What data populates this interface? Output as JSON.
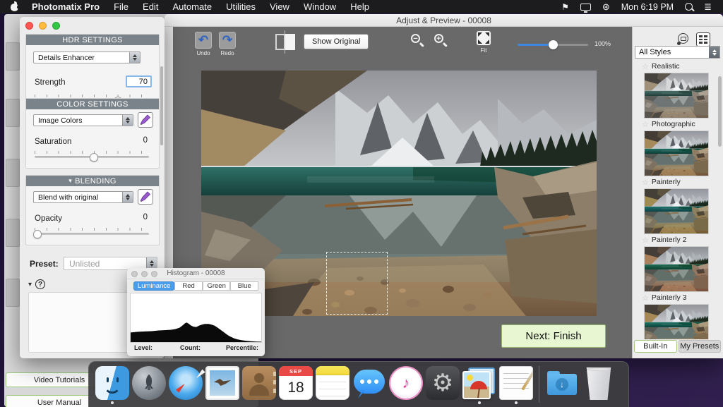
{
  "menu_bar": {
    "app_name": "Photomatix Pro",
    "items": [
      "File",
      "Edit",
      "Automate",
      "Utilities",
      "View",
      "Window",
      "Help"
    ],
    "clock": "Mon 6:19 PM"
  },
  "adjust_window": {
    "title": "Adjust & Preview - 00008",
    "toolbar": {
      "undo": "Undo",
      "redo": "Redo",
      "show_original": "Show Original",
      "fit": "Fit",
      "zoom_percent": "100%"
    },
    "next_button": "Next: Finish"
  },
  "settings_panel": {
    "hdr": {
      "header": "HDR SETTINGS",
      "method": "Details Enhancer",
      "strength": {
        "label": "Strength",
        "value": "70"
      }
    },
    "color": {
      "header": "COLOR SETTINGS",
      "mode": "Image Colors",
      "saturation": {
        "label": "Saturation",
        "value": "0"
      }
    },
    "blending": {
      "header": "BLENDING",
      "mode": "Blend with original",
      "opacity": {
        "label": "Opacity",
        "value": "0"
      }
    },
    "preset": {
      "label": "Preset:",
      "value": "Unlisted"
    }
  },
  "histogram_window": {
    "title": "Histogram - 00008",
    "tabs": [
      {
        "label": "Luminance",
        "cls": "active"
      },
      {
        "label": "Red",
        "cls": ""
      },
      {
        "label": "Green",
        "cls": ""
      },
      {
        "label": "Blue",
        "cls": ""
      }
    ],
    "footer": {
      "level": "Level:",
      "count": "Count:",
      "percentile": "Percentile:"
    }
  },
  "styles_panel": {
    "filter_value": "All Styles",
    "first_label": "Realistic",
    "items": [
      {
        "label": "Photographic",
        "cls": "th-photographic"
      },
      {
        "label": "Painterly",
        "cls": "th-painterly"
      },
      {
        "label": "Painterly 2",
        "cls": "th-painterly2"
      },
      {
        "label": "Painterly 3",
        "cls": "th-painterly3"
      }
    ],
    "tabs": [
      {
        "label": "Built-In",
        "cls": "active"
      },
      {
        "label": "My Presets",
        "cls": ""
      }
    ]
  },
  "background_window": {
    "buttons": [
      "Video Tutorials",
      "User Manual"
    ]
  },
  "dock": {
    "items": [
      "finder",
      "launchpad",
      "safari",
      "mail",
      "contacts",
      "calendar",
      "notes",
      "messages",
      "itunes",
      "system-preferences",
      "photomatix",
      "textedit",
      "downloads-folder",
      "trash"
    ],
    "calendar": {
      "month": "SEP",
      "day": "18"
    }
  },
  "colors": {
    "accent_blue": "#3f87e0",
    "histogram_tab_blue": "#4a9ded",
    "next_button_bg": "#e9f6d2",
    "green_border": "#a4cb80",
    "section_header_gray": "#7b838a"
  }
}
